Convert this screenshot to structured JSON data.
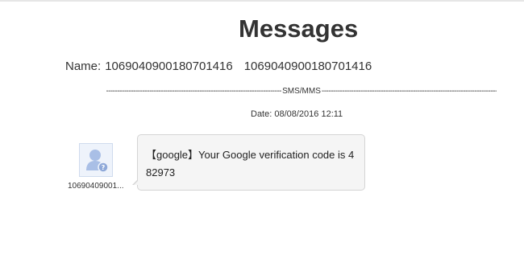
{
  "page": {
    "title": "Messages"
  },
  "contact": {
    "name_label": "Name:",
    "name_value_1": "1069040900180701416",
    "name_value_2": "1069040900180701416"
  },
  "separator": {
    "dashes_left": "--------------------------------------------------------------------------------------------",
    "label": "SMS/MMS",
    "dashes_right": "--------------------------------------------------------------------------------------------"
  },
  "message": {
    "date_label": "Date: 08/08/2016 12:11",
    "sender_short": "10690409001...",
    "body": "【google】Your Google verification code is 482973",
    "avatar_icon": "unknown-contact-icon"
  },
  "colors": {
    "avatar_bg": "#eef3fb",
    "avatar_figure": "#a9bfe6",
    "bubble_bg": "#f5f5f5",
    "bubble_border": "#d4d4d4"
  }
}
